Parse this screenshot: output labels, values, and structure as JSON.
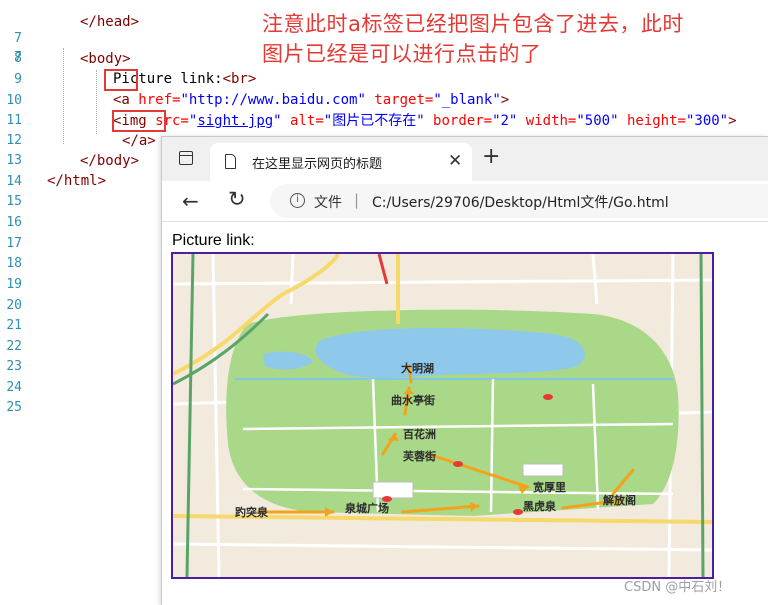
{
  "editor": {
    "lines": [
      {
        "num": "7",
        "code": ""
      },
      {
        "num": "8",
        "code": "<body>"
      },
      {
        "num": "9",
        "code": "Picture link:<br>"
      },
      {
        "num": "10",
        "code": "<a href=\"http://www.baidu.com\" target=\"_blank\">"
      },
      {
        "num": "11",
        "code": "<img src=\"sight.jpg\" alt=\"图片已不存在\" border=\"2\" width=\"500\" height=\"300\">"
      },
      {
        "num": "12",
        "code": "</a>"
      },
      {
        "num": "13",
        "code": "</body>"
      },
      {
        "num": "14",
        "code": "</html>"
      },
      {
        "num": "15",
        "code": ""
      },
      {
        "num": "16",
        "code": ""
      },
      {
        "num": "17",
        "code": ""
      },
      {
        "num": "18",
        "code": ""
      },
      {
        "num": "19",
        "code": ""
      },
      {
        "num": "20",
        "code": ""
      },
      {
        "num": "21",
        "code": ""
      },
      {
        "num": "22",
        "code": ""
      },
      {
        "num": "23",
        "code": ""
      },
      {
        "num": "24",
        "code": ""
      },
      {
        "num": "25",
        "code": ""
      }
    ],
    "top_cut": "</head>",
    "l8_tag": "<body>",
    "l9_text": "Picture link:",
    "l9_br": "<br>",
    "l10_a": "<a",
    "l10_href_attr": " href=",
    "l10_href_val": "\"http://www.baidu.com\"",
    "l10_target_attr": " target=",
    "l10_target_val": "\"_blank\"",
    "l10_close": ">",
    "l11_img": "<img",
    "l11_src_attr": " src=",
    "l11_src_q1": "\"",
    "l11_src_val": "sight.jpg",
    "l11_src_q2": "\"",
    "l11_alt_attr": " alt=",
    "l11_alt_val": "\"图片已不存在\"",
    "l11_border_attr": " border=",
    "l11_border_val": "\"2\"",
    "l11_width_attr": " width=",
    "l11_width_val": "\"500\"",
    "l11_height_attr": " height=",
    "l11_height_val": "\"300\"",
    "l11_close": ">",
    "l12_tag": "</a>",
    "l13_tag": "</body>",
    "l14_tag": "</html>"
  },
  "annotation": {
    "line1": "注意此时a标签已经把图片包含了进去，此时",
    "line2": "图片已经是可以进行点击的了"
  },
  "browser": {
    "tab_title": "在这里显示网页的标题",
    "tab_close": "✕",
    "new_tab": "+",
    "back": "←",
    "reload": "↻",
    "info": "i",
    "file_label": "文件",
    "separator": "|",
    "url": "C:/Users/29706/Desktop/Html文件/Go.html",
    "page_text": "Picture link:"
  },
  "map": {
    "labels": [
      "大明湖",
      "曲水亭街",
      "百花洲",
      "芙蓉街",
      "宽厚里",
      "解放阁",
      "趵突泉",
      "泉城广场",
      "黑虎泉"
    ],
    "colors": {
      "park": "#a9d889",
      "water": "#8ec9ec",
      "road": "#ffffff",
      "arrow": "#f4a21a",
      "pin": "#e53935"
    }
  },
  "watermark": "CSDN @中石刘！"
}
